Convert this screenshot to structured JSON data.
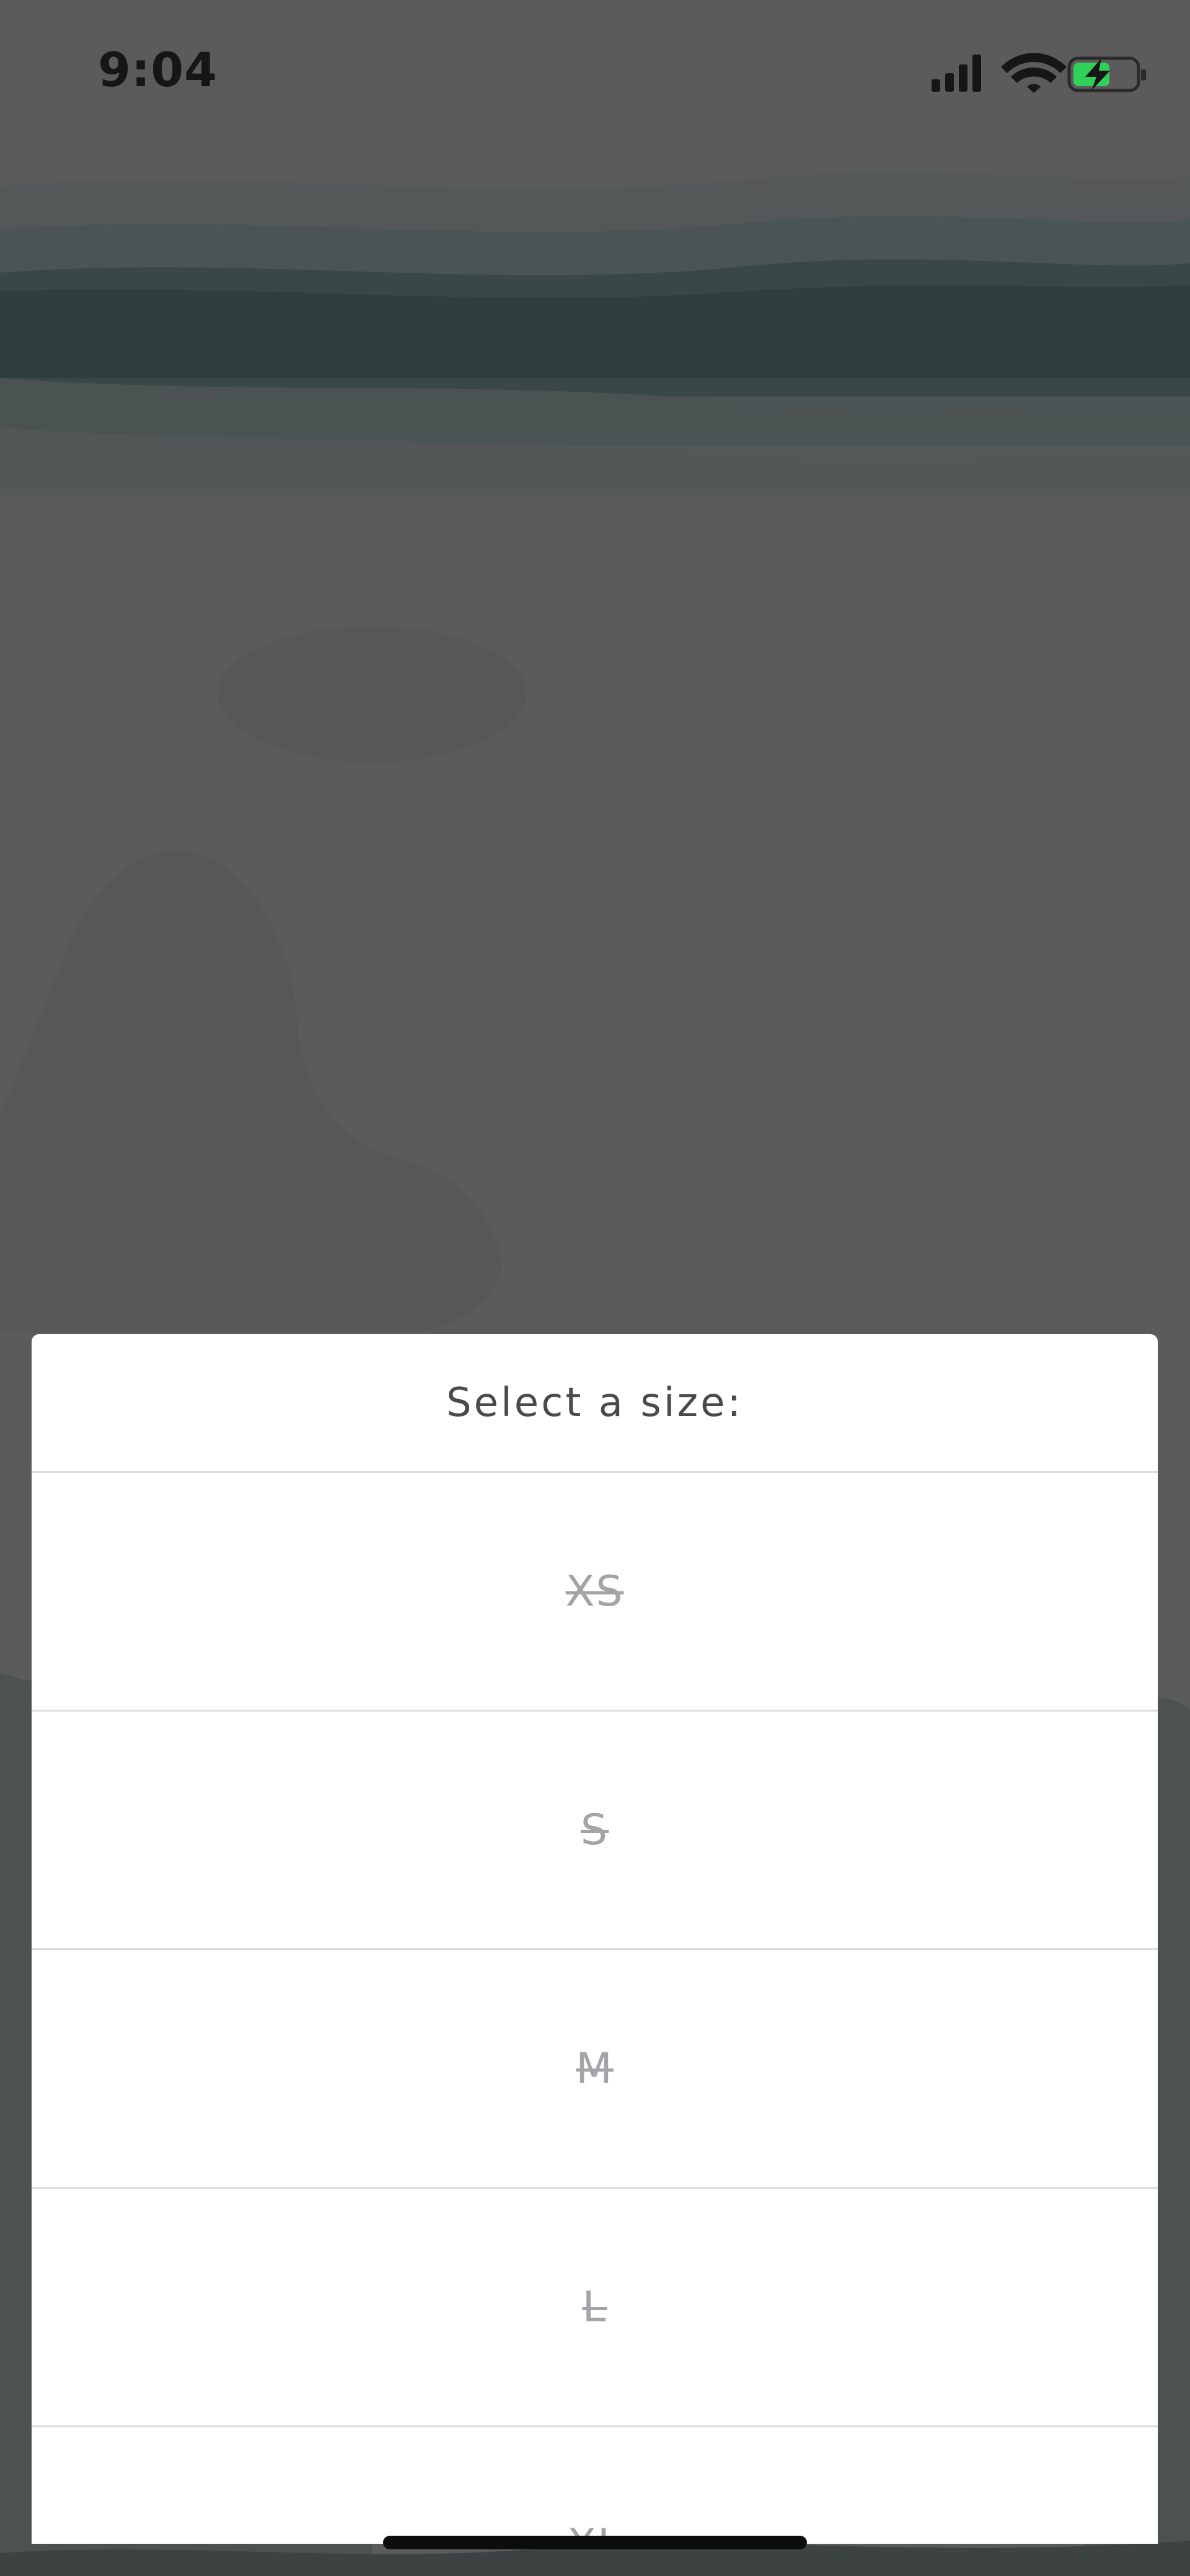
{
  "status_bar": {
    "time": "9:04",
    "signal_icon": "cellular-signal-icon",
    "wifi_icon": "wifi-icon",
    "battery_icon": "battery-charging-icon",
    "battery_color": "#30d158"
  },
  "size_sheet": {
    "title": "Select a size:",
    "options": [
      {
        "label": "XS",
        "available": false
      },
      {
        "label": "S",
        "available": false
      },
      {
        "label": "M",
        "available": false
      },
      {
        "label": "L",
        "available": false
      },
      {
        "label": "XL",
        "available": false
      }
    ]
  },
  "colors": {
    "overlay": "#5b5b5b",
    "sheet_background": "#ffffff",
    "unavailable_text": "#a3a3a8",
    "divider": "#dcdcde"
  }
}
